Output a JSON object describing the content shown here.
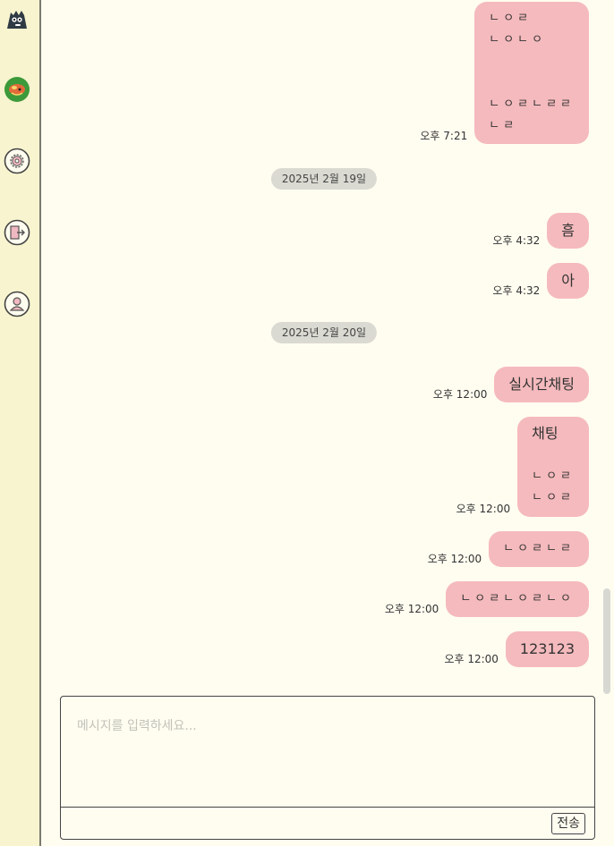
{
  "sidebar": {
    "items": [
      {
        "name": "logo-icon"
      },
      {
        "name": "avatar"
      },
      {
        "name": "settings-icon"
      },
      {
        "name": "logout-icon"
      },
      {
        "name": "profile-icon"
      }
    ]
  },
  "chat": {
    "messages": [
      {
        "lines": [
          "ㄴㅇㄹ",
          "ㄴㅇㄴㅇ",
          "",
          "",
          "ㄴㅇㄹㄴㄹㄹ",
          "ㄴㄹ"
        ],
        "time": "오후 7:21"
      },
      {
        "date": "2025년 2월 19일"
      },
      {
        "lines": [
          "흠"
        ],
        "time": "오후 4:32"
      },
      {
        "lines": [
          "아"
        ],
        "time": "오후 4:32"
      },
      {
        "date": "2025년 2월 20일"
      },
      {
        "lines": [
          "실시간채팅"
        ],
        "time": "오후 12:00"
      },
      {
        "lines": [
          "채팅",
          "",
          "ㄴㅇㄹ",
          "ㄴㅇㄹ"
        ],
        "time": "오후 12:00"
      },
      {
        "lines": [
          "ㄴㅇㄹㄴㄹ"
        ],
        "time": "오후 12:00"
      },
      {
        "lines": [
          "ㄴㅇㄹㄴㅇㄹㄴㅇ"
        ],
        "time": "오후 12:00"
      },
      {
        "lines": [
          "123123"
        ],
        "time": "오후 12:00"
      }
    ]
  },
  "composer": {
    "placeholder": "메시지를 입력하세요...",
    "value": "",
    "send_label": "전송"
  },
  "colors": {
    "bubble": "#f5babd",
    "background": "#fffdf0",
    "sidebar": "#f7f4cf",
    "date_pill": "#dadad2"
  }
}
